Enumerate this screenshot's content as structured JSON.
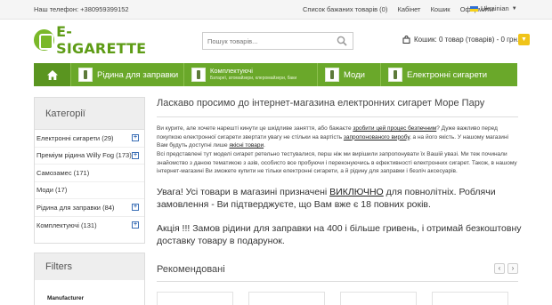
{
  "topbar": {
    "phone": "Наш телефон: +380959399152",
    "links": [
      "Список бажаних товарів (0)",
      "Кабінет",
      "Кошик",
      "Оформити"
    ],
    "language": "Ukrainian"
  },
  "header": {
    "logo_text": "E-SIGARETTE",
    "search_placeholder": "Пошук товарів...",
    "cart_text": "Кошик: 0 товар (товарів) - 0 грн."
  },
  "nav": {
    "items": [
      {
        "label": "Рідина для заправки"
      },
      {
        "label": "Комплектуючі",
        "sublabel": "Батареї, атомайзери, клеромайзери, баки"
      },
      {
        "label": "Моди"
      },
      {
        "label": "Електронні сигарети"
      }
    ]
  },
  "sidebar": {
    "categories_title": "Категорії",
    "categories": [
      {
        "label": "Електронні сигарети (29)",
        "expandable": true
      },
      {
        "label": "Преміум рідина Willy Fog (173)",
        "expandable": true
      },
      {
        "label": "Самозамес (171)",
        "expandable": false
      },
      {
        "label": "Моди (17)",
        "expandable": false
      },
      {
        "label": "Рідина для заправки (84)",
        "expandable": true
      },
      {
        "label": "Комплектуючі (131)",
        "expandable": true
      }
    ],
    "filters_title": "Filters",
    "manufacturer_label": "Manufacturer"
  },
  "main": {
    "welcome": "Ласкаво просимо до інтернет-магазина електронних сигарет Море Пару",
    "para1": {
      "a": "Ви курите, але хочете нарешті кинути це шкідливе заняття, або бажаєте ",
      "b": "зробити цей процес безпечним",
      "c": "? Дуже важливо перед покупкою електронної сигарети звертати увагу не стільки на вартість ",
      "d": "запропонованого виробу",
      "e": ", а на його якість. У нашому магазині Вам будуть доступні лише ",
      "f": "якісні товари",
      "g": "."
    },
    "para2": "Всі представлені тут моделі сигарет ретельно тестувалися, перш ніж ми вирішили запропонувати їх Вашій увазі. Ми теж починали знайомство з даною тематикою з азів, особисто все пробуючи і переконуючись в ефективності електронних сигарет. Також, в нашому інтернет-магазині Ви зможете купити не тільки електронні сигарети, а й рідину для заправки і безліч аксесуарів.",
    "warning": {
      "a": "Увага! Усі товари в магазині призначені ",
      "b": "ВИКЛЮЧНО",
      "c": " для повнолітніх. Роблячи замовлення - Ви підтверджуєте, що Вам вже є 18 повних років."
    },
    "promo": "Акція !!! Замов рідини для заправки на 400 і більше гривень, і отримай безкоштовну доставку товару в подарунок.",
    "recommended_title": "Рекомендовані",
    "rec_prev": "‹",
    "rec_next": "›"
  },
  "colors": {
    "brand_green": "#6aa82a",
    "accent_yellow": "#f0c419",
    "plus_blue": "#3b6fb6"
  }
}
